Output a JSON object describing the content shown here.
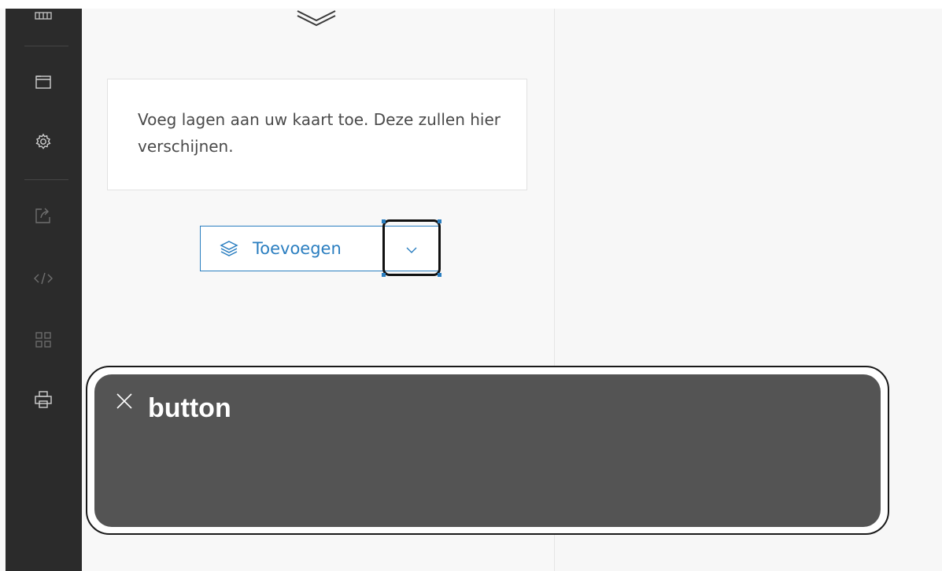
{
  "sidebar": {
    "items": [
      {
        "icon": "bar-chart-icon"
      },
      {
        "icon": "folder-icon"
      },
      {
        "icon": "gear-icon"
      },
      {
        "icon": "share-icon"
      },
      {
        "icon": "code-icon"
      },
      {
        "icon": "apps-grid-icon"
      },
      {
        "icon": "print-icon"
      }
    ]
  },
  "layers_panel": {
    "empty_message": "Voeg lagen aan uw kaart toe. Deze zullen hier verschijnen.",
    "add_button_label": "Toevoegen"
  },
  "tooltip": {
    "text": "button"
  },
  "colors": {
    "accent": "#2a7ec0",
    "sidebar_bg": "#2b2b2b",
    "tooltip_bg": "#545454"
  }
}
